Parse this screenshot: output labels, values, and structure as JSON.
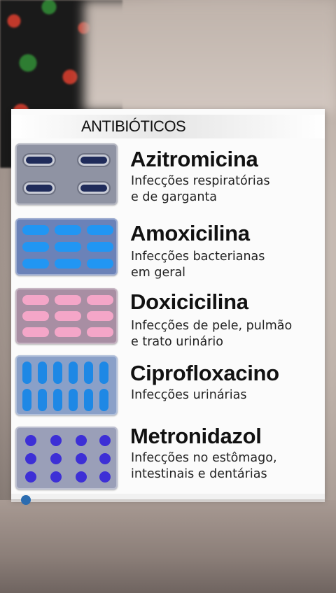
{
  "title": "ANTIBIÓTICOS",
  "medicines": [
    {
      "name": "Azitromicina",
      "desc_line1": "Infecções respiratórias",
      "desc_line2": "e de garganta",
      "pack_color": "#8f93a3",
      "pill_color": "#1f2b5a",
      "pill_shape": "capsule-horizontal"
    },
    {
      "name": "Amoxicilina",
      "desc_line1": "Infecções bacterianas",
      "desc_line2": "em geral",
      "pack_color": "#6b82b8",
      "pill_color": "#2196f3",
      "pill_shape": "capsule-horizontal"
    },
    {
      "name": "Doxicicilina",
      "desc_line1": "Infecções de pele, pulmão",
      "desc_line2": "e trato urinário",
      "pack_color": "#a88ea3",
      "pill_color": "#f4a6c8",
      "pill_shape": "capsule-horizontal"
    },
    {
      "name": "Ciprofloxacino",
      "desc_line1": "Infecções urinárias",
      "desc_line2": "",
      "pack_color": "#8aa0c8",
      "pill_color": "#1e88e5",
      "pill_shape": "capsule-vertical"
    },
    {
      "name": "Metronidazol",
      "desc_line1": "Infecções no estômago,",
      "desc_line2": "intestinais e dentárias",
      "pack_color": "#9a9fb8",
      "pill_color": "#3d2fd6",
      "pill_shape": "round"
    }
  ]
}
